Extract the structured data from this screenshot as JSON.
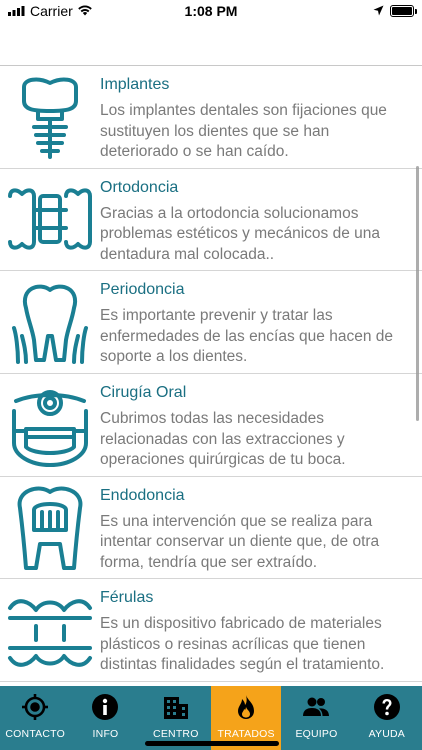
{
  "status_bar": {
    "carrier": "Carrier",
    "time": "1:08 PM"
  },
  "treatments": [
    {
      "title": "Implantes",
      "icon": "implant-icon",
      "lines": [
        "Los implantes dentales son fijaciones que",
        "sustituyen los dientes que se han",
        "deteriorado o se han caído."
      ]
    },
    {
      "title": "Ortodoncia",
      "icon": "braces-icon",
      "lines": [
        "Gracias a la ortodoncia solucionamos",
        "problemas estéticos y mecánicos de una",
        "dentadura mal colocada.."
      ]
    },
    {
      "title": "Periodoncia",
      "icon": "gum-tooth-icon",
      "lines": [
        "Es importante prevenir y tratar las",
        "enfermedades de las encías que hacen de",
        "soporte a los dientes."
      ]
    },
    {
      "title": "Cirugía Oral",
      "icon": "surgeon-icon",
      "lines": [
        "Cubrimos todas las necesidades",
        "relacionadas con las extracciones y",
        "operaciones quirúrgicas de tu boca."
      ]
    },
    {
      "title": "Endodoncia",
      "icon": "root-canal-icon",
      "lines": [
        "Es una intervención que se realiza para",
        "intentar conservar un diente que, de otra",
        "forma, tendría que ser extraído."
      ]
    },
    {
      "title": "Férulas",
      "icon": "splint-icon",
      "lines": [
        "Es un dispositivo fabricado de materiales",
        "plásticos o resinas acrílicas que tienen",
        "distintas finalidades según el tratamiento."
      ]
    }
  ],
  "tabs": [
    {
      "label": "CONTACTO",
      "icon": "location-target-icon"
    },
    {
      "label": "INFO",
      "icon": "info-icon"
    },
    {
      "label": "CENTRO",
      "icon": "building-icon"
    },
    {
      "label": "TRATADOS",
      "icon": "flame-icon",
      "active": true
    },
    {
      "label": "EQUIPO",
      "icon": "people-icon"
    },
    {
      "label": "AYUDA",
      "icon": "help-icon"
    }
  ],
  "colors": {
    "accent": "#1a6f82",
    "tabbar": "#2a7d8e",
    "tab_active": "#f5a31a"
  }
}
